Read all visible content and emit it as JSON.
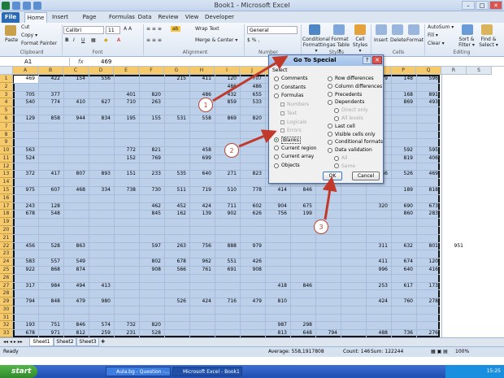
{
  "window": {
    "title": "Book1 - Microsoft Excel"
  },
  "ribbon_tabs": [
    "File",
    "Home",
    "Insert",
    "Page Layout",
    "Formulas",
    "Data",
    "Review",
    "View",
    "Developer"
  ],
  "ribbon": {
    "paste": "Paste",
    "cut": "Cut",
    "copy": "Copy ▾",
    "format_painter": "Format Painter",
    "font_name": "Calibri",
    "font_size": "11",
    "wrap_text": "Wrap Text",
    "merge_center": "Merge & Center ▾",
    "number_format": "General",
    "conditional_formatting": "Conditional Formatting ▾",
    "format_as_table": "Format as Table ▾",
    "cell_styles": "Cell Styles ▾",
    "insert": "Insert",
    "delete": "Delete",
    "format": "Format",
    "autosum": "AutoSum ▾",
    "fill": "Fill ▾",
    "clear": "Clear ▾",
    "sort_filter": "Sort & Filter ▾",
    "find_select": "Find & Select ▾",
    "groups": [
      "Clipboard",
      "Font",
      "Alignment",
      "Number",
      "Styles",
      "Cells",
      "Editing"
    ]
  },
  "formula_bar": {
    "name_box": "A1",
    "fx": "fx",
    "value": "469"
  },
  "columns": [
    "A",
    "B",
    "C",
    "D",
    "E",
    "F",
    "G",
    "H",
    "I",
    "J",
    "K",
    "L",
    "M",
    "N",
    "O",
    "P",
    "Q",
    "R",
    "S"
  ],
  "rows": [
    "1",
    "2",
    "3",
    "4",
    "5",
    "6",
    "7",
    "8",
    "9",
    "10",
    "11",
    "12",
    "13",
    "14",
    "15",
    "16",
    "17",
    "18",
    "19",
    "20",
    "21",
    "22",
    "23",
    "24",
    "25",
    "26",
    "27",
    "28",
    "29",
    "30",
    "31",
    "32",
    "33"
  ],
  "cells": [
    {
      "r": 1,
      "c": 0,
      "v": "469"
    },
    {
      "r": 1,
      "c": 1,
      "v": "422"
    },
    {
      "r": 1,
      "c": 2,
      "v": "154"
    },
    {
      "r": 1,
      "c": 3,
      "v": "556"
    },
    {
      "r": 1,
      "c": 6,
      "v": "215"
    },
    {
      "r": 1,
      "c": 7,
      "v": "411"
    },
    {
      "r": 1,
      "c": 8,
      "v": "120"
    },
    {
      "r": 1,
      "c": 9,
      "v": "707"
    },
    {
      "r": 1,
      "c": 14,
      "v": "79"
    },
    {
      "r": 1,
      "c": 15,
      "v": "148"
    },
    {
      "r": 1,
      "c": 16,
      "v": "596"
    },
    {
      "r": 2,
      "c": 8,
      "v": "486"
    },
    {
      "r": 2,
      "c": 9,
      "v": "486"
    },
    {
      "r": 3,
      "c": 0,
      "v": "705"
    },
    {
      "r": 3,
      "c": 1,
      "v": "377"
    },
    {
      "r": 3,
      "c": 4,
      "v": "401"
    },
    {
      "r": 3,
      "c": 5,
      "v": "820"
    },
    {
      "r": 3,
      "c": 7,
      "v": "486"
    },
    {
      "r": 3,
      "c": 8,
      "v": "432"
    },
    {
      "r": 3,
      "c": 9,
      "v": "655"
    },
    {
      "r": 3,
      "c": 15,
      "v": "168"
    },
    {
      "r": 3,
      "c": 16,
      "v": "891"
    },
    {
      "r": 4,
      "c": 0,
      "v": "540"
    },
    {
      "r": 4,
      "c": 1,
      "v": "774"
    },
    {
      "r": 4,
      "c": 2,
      "v": "410"
    },
    {
      "r": 4,
      "c": 3,
      "v": "627"
    },
    {
      "r": 4,
      "c": 4,
      "v": "710"
    },
    {
      "r": 4,
      "c": 5,
      "v": "263"
    },
    {
      "r": 4,
      "c": 8,
      "v": "859"
    },
    {
      "r": 4,
      "c": 9,
      "v": "533"
    },
    {
      "r": 4,
      "c": 15,
      "v": "869"
    },
    {
      "r": 4,
      "c": 16,
      "v": "493"
    },
    {
      "r": 6,
      "c": 0,
      "v": "129"
    },
    {
      "r": 6,
      "c": 1,
      "v": "858"
    },
    {
      "r": 6,
      "c": 2,
      "v": "944"
    },
    {
      "r": 6,
      "c": 3,
      "v": "834"
    },
    {
      "r": 6,
      "c": 4,
      "v": "195"
    },
    {
      "r": 6,
      "c": 5,
      "v": "155"
    },
    {
      "r": 6,
      "c": 6,
      "v": "531"
    },
    {
      "r": 6,
      "c": 7,
      "v": "558"
    },
    {
      "r": 6,
      "c": 8,
      "v": "869"
    },
    {
      "r": 6,
      "c": 9,
      "v": "820"
    },
    {
      "r": 10,
      "c": 0,
      "v": "563"
    },
    {
      "r": 10,
      "c": 4,
      "v": "772"
    },
    {
      "r": 10,
      "c": 5,
      "v": "821"
    },
    {
      "r": 10,
      "c": 7,
      "v": "458"
    },
    {
      "r": 10,
      "c": 15,
      "v": "592"
    },
    {
      "r": 10,
      "c": 16,
      "v": "595"
    },
    {
      "r": 11,
      "c": 0,
      "v": "524"
    },
    {
      "r": 11,
      "c": 4,
      "v": "152"
    },
    {
      "r": 11,
      "c": 5,
      "v": "769"
    },
    {
      "r": 11,
      "c": 7,
      "v": "699"
    },
    {
      "r": 11,
      "c": 15,
      "v": "819"
    },
    {
      "r": 11,
      "c": 16,
      "v": "406"
    },
    {
      "r": 13,
      "c": 0,
      "v": "372"
    },
    {
      "r": 13,
      "c": 1,
      "v": "417"
    },
    {
      "r": 13,
      "c": 2,
      "v": "807"
    },
    {
      "r": 13,
      "c": 3,
      "v": "893"
    },
    {
      "r": 13,
      "c": 4,
      "v": "151"
    },
    {
      "r": 13,
      "c": 5,
      "v": "233"
    },
    {
      "r": 13,
      "c": 6,
      "v": "535"
    },
    {
      "r": 13,
      "c": 7,
      "v": "640"
    },
    {
      "r": 13,
      "c": 8,
      "v": "271"
    },
    {
      "r": 13,
      "c": 9,
      "v": "823"
    },
    {
      "r": 13,
      "c": 14,
      "v": "566"
    },
    {
      "r": 13,
      "c": 15,
      "v": "526"
    },
    {
      "r": 13,
      "c": 16,
      "v": "469"
    },
    {
      "r": 15,
      "c": 0,
      "v": "975"
    },
    {
      "r": 15,
      "c": 1,
      "v": "607"
    },
    {
      "r": 15,
      "c": 2,
      "v": "468"
    },
    {
      "r": 15,
      "c": 3,
      "v": "334"
    },
    {
      "r": 15,
      "c": 4,
      "v": "738"
    },
    {
      "r": 15,
      "c": 5,
      "v": "730"
    },
    {
      "r": 15,
      "c": 6,
      "v": "511"
    },
    {
      "r": 15,
      "c": 7,
      "v": "719"
    },
    {
      "r": 15,
      "c": 8,
      "v": "510"
    },
    {
      "r": 15,
      "c": 9,
      "v": "778"
    },
    {
      "r": 15,
      "c": 10,
      "v": "414"
    },
    {
      "r": 15,
      "c": 11,
      "v": "846"
    },
    {
      "r": 15,
      "c": 15,
      "v": "189"
    },
    {
      "r": 15,
      "c": 16,
      "v": "818"
    },
    {
      "r": 17,
      "c": 0,
      "v": "243"
    },
    {
      "r": 17,
      "c": 1,
      "v": "128"
    },
    {
      "r": 17,
      "c": 5,
      "v": "462"
    },
    {
      "r": 17,
      "c": 6,
      "v": "452"
    },
    {
      "r": 17,
      "c": 7,
      "v": "424"
    },
    {
      "r": 17,
      "c": 8,
      "v": "711"
    },
    {
      "r": 17,
      "c": 9,
      "v": "602"
    },
    {
      "r": 17,
      "c": 10,
      "v": "904"
    },
    {
      "r": 17,
      "c": 11,
      "v": "675"
    },
    {
      "r": 17,
      "c": 14,
      "v": "320"
    },
    {
      "r": 17,
      "c": 15,
      "v": "690"
    },
    {
      "r": 17,
      "c": 16,
      "v": "673"
    },
    {
      "r": 18,
      "c": 0,
      "v": "678"
    },
    {
      "r": 18,
      "c": 1,
      "v": "548"
    },
    {
      "r": 18,
      "c": 5,
      "v": "845"
    },
    {
      "r": 18,
      "c": 6,
      "v": "162"
    },
    {
      "r": 18,
      "c": 7,
      "v": "139"
    },
    {
      "r": 18,
      "c": 8,
      "v": "902"
    },
    {
      "r": 18,
      "c": 9,
      "v": "626"
    },
    {
      "r": 18,
      "c": 10,
      "v": "756"
    },
    {
      "r": 18,
      "c": 11,
      "v": "199"
    },
    {
      "r": 18,
      "c": 15,
      "v": "860"
    },
    {
      "r": 18,
      "c": 16,
      "v": "283"
    },
    {
      "r": 22,
      "c": 0,
      "v": "456"
    },
    {
      "r": 22,
      "c": 1,
      "v": "528"
    },
    {
      "r": 22,
      "c": 2,
      "v": "863"
    },
    {
      "r": 22,
      "c": 5,
      "v": "597"
    },
    {
      "r": 22,
      "c": 6,
      "v": "263"
    },
    {
      "r": 22,
      "c": 7,
      "v": "756"
    },
    {
      "r": 22,
      "c": 8,
      "v": "888"
    },
    {
      "r": 22,
      "c": 9,
      "v": "979"
    },
    {
      "r": 22,
      "c": 14,
      "v": "311"
    },
    {
      "r": 22,
      "c": 15,
      "v": "632"
    },
    {
      "r": 22,
      "c": 16,
      "v": "801"
    },
    {
      "r": 22,
      "c": 17,
      "v": "951"
    },
    {
      "r": 24,
      "c": 0,
      "v": "583"
    },
    {
      "r": 24,
      "c": 1,
      "v": "557"
    },
    {
      "r": 24,
      "c": 2,
      "v": "549"
    },
    {
      "r": 24,
      "c": 5,
      "v": "802"
    },
    {
      "r": 24,
      "c": 6,
      "v": "678"
    },
    {
      "r": 24,
      "c": 7,
      "v": "962"
    },
    {
      "r": 24,
      "c": 8,
      "v": "551"
    },
    {
      "r": 24,
      "c": 9,
      "v": "426"
    },
    {
      "r": 24,
      "c": 14,
      "v": "411"
    },
    {
      "r": 24,
      "c": 15,
      "v": "674"
    },
    {
      "r": 24,
      "c": 16,
      "v": "120"
    },
    {
      "r": 25,
      "c": 0,
      "v": "922"
    },
    {
      "r": 25,
      "c": 1,
      "v": "868"
    },
    {
      "r": 25,
      "c": 2,
      "v": "874"
    },
    {
      "r": 25,
      "c": 5,
      "v": "908"
    },
    {
      "r": 25,
      "c": 6,
      "v": "566"
    },
    {
      "r": 25,
      "c": 7,
      "v": "761"
    },
    {
      "r": 25,
      "c": 8,
      "v": "691"
    },
    {
      "r": 25,
      "c": 9,
      "v": "908"
    },
    {
      "r": 25,
      "c": 14,
      "v": "996"
    },
    {
      "r": 25,
      "c": 15,
      "v": "640"
    },
    {
      "r": 25,
      "c": 16,
      "v": "416"
    },
    {
      "r": 27,
      "c": 0,
      "v": "317"
    },
    {
      "r": 27,
      "c": 1,
      "v": "984"
    },
    {
      "r": 27,
      "c": 2,
      "v": "494"
    },
    {
      "r": 27,
      "c": 3,
      "v": "413"
    },
    {
      "r": 27,
      "c": 10,
      "v": "418"
    },
    {
      "r": 27,
      "c": 11,
      "v": "846"
    },
    {
      "r": 27,
      "c": 14,
      "v": "253"
    },
    {
      "r": 27,
      "c": 15,
      "v": "617"
    },
    {
      "r": 27,
      "c": 16,
      "v": "173"
    },
    {
      "r": 29,
      "c": 0,
      "v": "794"
    },
    {
      "r": 29,
      "c": 1,
      "v": "848"
    },
    {
      "r": 29,
      "c": 2,
      "v": "479"
    },
    {
      "r": 29,
      "c": 3,
      "v": "980"
    },
    {
      "r": 29,
      "c": 6,
      "v": "526"
    },
    {
      "r": 29,
      "c": 7,
      "v": "424"
    },
    {
      "r": 29,
      "c": 8,
      "v": "716"
    },
    {
      "r": 29,
      "c": 9,
      "v": "479"
    },
    {
      "r": 29,
      "c": 10,
      "v": "810"
    },
    {
      "r": 29,
      "c": 14,
      "v": "424"
    },
    {
      "r": 29,
      "c": 15,
      "v": "760"
    },
    {
      "r": 29,
      "c": 16,
      "v": "278"
    },
    {
      "r": 32,
      "c": 0,
      "v": "193"
    },
    {
      "r": 32,
      "c": 1,
      "v": "751"
    },
    {
      "r": 32,
      "c": 2,
      "v": "846"
    },
    {
      "r": 32,
      "c": 3,
      "v": "574"
    },
    {
      "r": 32,
      "c": 4,
      "v": "732"
    },
    {
      "r": 32,
      "c": 5,
      "v": "820"
    },
    {
      "r": 32,
      "c": 10,
      "v": "987"
    },
    {
      "r": 32,
      "c": 11,
      "v": "298"
    },
    {
      "r": 33,
      "c": 0,
      "v": "678"
    },
    {
      "r": 33,
      "c": 1,
      "v": "971"
    },
    {
      "r": 33,
      "c": 2,
      "v": "812"
    },
    {
      "r": 33,
      "c": 3,
      "v": "259"
    },
    {
      "r": 33,
      "c": 4,
      "v": "231"
    },
    {
      "r": 33,
      "c": 5,
      "v": "528"
    },
    {
      "r": 33,
      "c": 10,
      "v": "813"
    },
    {
      "r": 33,
      "c": 11,
      "v": "648"
    },
    {
      "r": 33,
      "c": 12,
      "v": "794"
    },
    {
      "r": 33,
      "c": 14,
      "v": "488"
    },
    {
      "r": 33,
      "c": 15,
      "v": "736"
    },
    {
      "r": 33,
      "c": 16,
      "v": "276"
    }
  ],
  "dialog": {
    "title": "Go To Special",
    "help": "?",
    "close": "✕",
    "select_label": "Select",
    "left_options": [
      {
        "label": "Comments",
        "type": "radio",
        "state": "off"
      },
      {
        "label": "Constants",
        "type": "radio",
        "state": "off"
      },
      {
        "label": "Formulas",
        "type": "radio",
        "state": "off"
      },
      {
        "label": "Numbers",
        "type": "check",
        "state": "disabled"
      },
      {
        "label": "Text",
        "type": "check",
        "state": "disabled"
      },
      {
        "label": "Logicals",
        "type": "check",
        "state": "disabled"
      },
      {
        "label": "Errors",
        "type": "check",
        "state": "disabled"
      },
      {
        "label": "Blanks",
        "type": "radio",
        "state": "on"
      },
      {
        "label": "Current region",
        "type": "radio",
        "state": "off"
      },
      {
        "label": "Current array",
        "type": "radio",
        "state": "off"
      },
      {
        "label": "Objects",
        "type": "radio",
        "state": "off"
      }
    ],
    "right_options": [
      {
        "label": "Row differences",
        "type": "radio",
        "state": "off"
      },
      {
        "label": "Column differences",
        "type": "radio",
        "state": "off"
      },
      {
        "label": "Precedents",
        "type": "radio",
        "state": "off"
      },
      {
        "label": "Dependents",
        "type": "radio",
        "state": "off"
      },
      {
        "label": "Direct only",
        "type": "radio",
        "state": "disabled"
      },
      {
        "label": "All levels",
        "type": "radio",
        "state": "disabled"
      },
      {
        "label": "Last cell",
        "type": "radio",
        "state": "off"
      },
      {
        "label": "Visible cells only",
        "type": "radio",
        "state": "off"
      },
      {
        "label": "Conditional formats",
        "type": "radio",
        "state": "off"
      },
      {
        "label": "Data validation",
        "type": "radio",
        "state": "off"
      },
      {
        "label": "All",
        "type": "radio",
        "state": "disabled"
      },
      {
        "label": "Same",
        "type": "radio",
        "state": "disabled"
      }
    ],
    "ok": "OK",
    "cancel": "Cancel"
  },
  "callouts": [
    "1",
    "2",
    "3"
  ],
  "sheet_tabs": [
    "Sheet1",
    "Sheet2",
    "Sheet3"
  ],
  "status": {
    "ready": "Ready",
    "average": "Average: 558,1917808",
    "count": "Count: 146",
    "sum": "Sum: 122244",
    "zoom": "100%"
  },
  "taskbar": {
    "start": "start",
    "tasks": [
      "Aula.bg - Question -...",
      "Microsoft Excel - Book1"
    ],
    "time": "15:25"
  },
  "colors": {
    "selection": "#bcd0ea",
    "header_selected": "#f6c96a",
    "arrow": "#c0392b",
    "file_tab": "#2a6ab7"
  }
}
